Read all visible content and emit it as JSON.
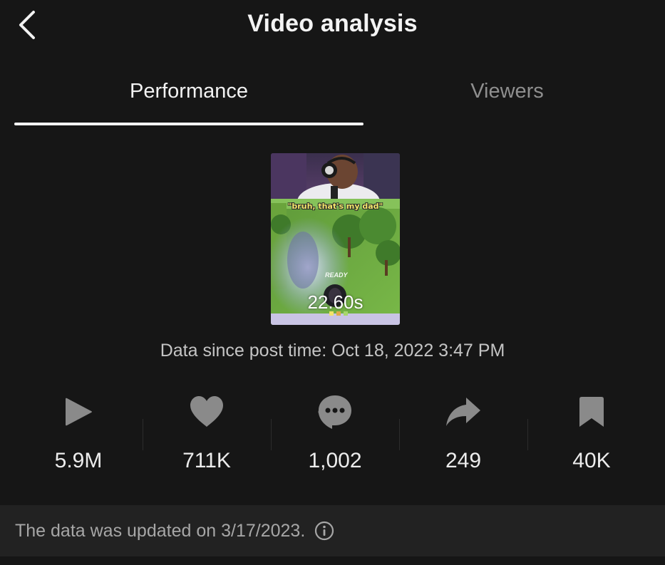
{
  "header": {
    "title": "Video analysis",
    "back_icon": "chevron-left-icon"
  },
  "tabs": [
    {
      "label": "Performance",
      "active": true
    },
    {
      "label": "Viewers",
      "active": false
    }
  ],
  "thumbnail": {
    "caption": "\"bruh, that's my dad\"",
    "ready_text": "READY",
    "timer_text": "22.60s"
  },
  "data_since": "Data since post time: Oct 18, 2022 3:47 PM",
  "stats": [
    {
      "icon": "play-icon",
      "value": "5.9M"
    },
    {
      "icon": "heart-icon",
      "value": "711K"
    },
    {
      "icon": "comment-icon",
      "value": "1,002"
    },
    {
      "icon": "share-icon",
      "value": "249"
    },
    {
      "icon": "bookmark-icon",
      "value": "40K"
    }
  ],
  "footer": {
    "text": "The data was updated on 3/17/2023.",
    "info_icon": "info-icon"
  },
  "colors": {
    "background": "#161616",
    "footer_background": "#222222",
    "icon_gray": "#8a8a8a",
    "active_tab": "#f2f2f2",
    "inactive_tab": "#8f8f8f"
  }
}
